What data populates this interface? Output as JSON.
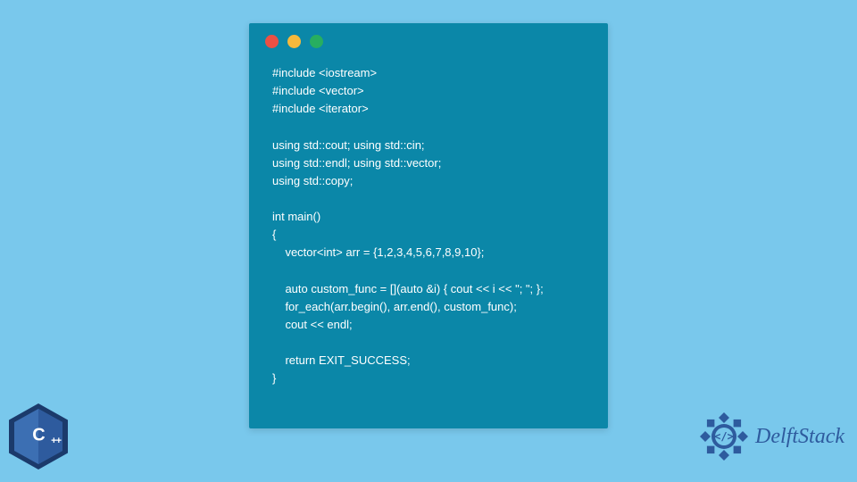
{
  "window": {
    "dots": [
      "red",
      "yellow",
      "green"
    ]
  },
  "code": "#include <iostream>\n#include <vector>\n#include <iterator>\n\nusing std::cout; using std::cin;\nusing std::endl; using std::vector;\nusing std::copy;\n\nint main()\n{\n    vector<int> arr = {1,2,3,4,5,6,7,8,9,10};\n\n    auto custom_func = [](auto &i) { cout << i << \"; \"; };\n    for_each(arr.begin(), arr.end(), custom_func);\n    cout << endl;\n\n    return EXIT_SUCCESS;\n}",
  "cpp_badge": {
    "label": "C",
    "plus": "++"
  },
  "brand": {
    "text": "DelftStack"
  },
  "colors": {
    "page_bg": "#79c8ec",
    "window_bg": "#0b87a8",
    "code_fg": "#ffffff",
    "brand_fg": "#2e5b9e",
    "cpp_outer": "#1b3a6b",
    "cpp_inner": "#3c6fb3"
  }
}
